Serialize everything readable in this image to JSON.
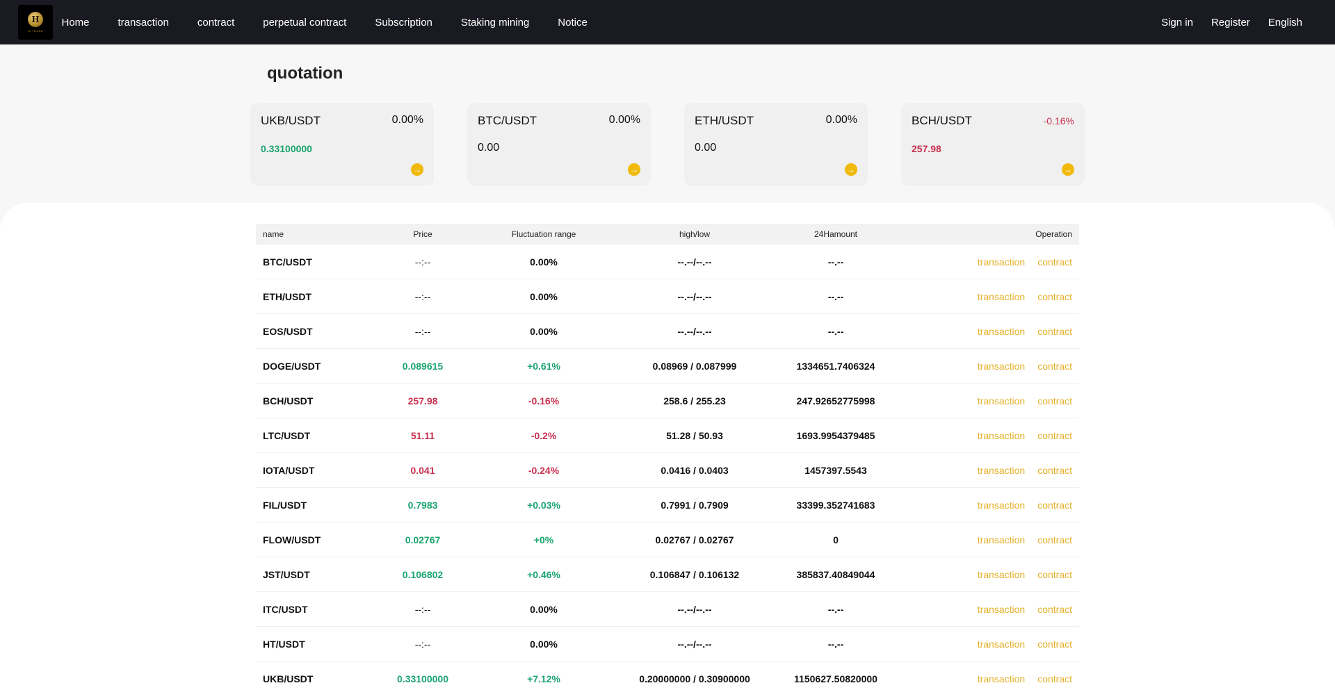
{
  "nav": {
    "logo_mark": "H",
    "logo_text": "HI TRADE",
    "links": [
      "Home",
      "transaction",
      "contract",
      "perpetual contract",
      "Subscription",
      "Staking mining",
      "Notice"
    ],
    "sign_in": "Sign in",
    "register": "Register",
    "language": "English"
  },
  "page_title": "quotation",
  "cards": [
    {
      "pair": "UKB/USDT",
      "change": "0.00%",
      "price": "0.33100000",
      "trend": "up"
    },
    {
      "pair": "BTC/USDT",
      "change": "0.00%",
      "price": "0.00",
      "trend": "flat"
    },
    {
      "pair": "ETH/USDT",
      "change": "0.00%",
      "price": "0.00",
      "trend": "flat"
    },
    {
      "pair": "BCH/USDT",
      "change": "-0.16%",
      "price": "257.98",
      "trend": "down"
    }
  ],
  "table": {
    "headers": {
      "name": "name",
      "price": "Price",
      "fluctuation": "Fluctuation range",
      "highlow": "high/low",
      "amount": "24Hamount",
      "operation": "Operation"
    },
    "op_transaction": "transaction",
    "op_contract": "contract",
    "rows": [
      {
        "name": "BTC/USDT",
        "price": "--:--",
        "change": "0.00%",
        "highlow": "--.--/--.--",
        "amount": "--.--",
        "trend": "flat"
      },
      {
        "name": "ETH/USDT",
        "price": "--:--",
        "change": "0.00%",
        "highlow": "--.--/--.--",
        "amount": "--.--",
        "trend": "flat"
      },
      {
        "name": "EOS/USDT",
        "price": "--:--",
        "change": "0.00%",
        "highlow": "--.--/--.--",
        "amount": "--.--",
        "trend": "flat"
      },
      {
        "name": "DOGE/USDT",
        "price": "0.089615",
        "change": "+0.61%",
        "highlow": "0.08969 / 0.087999",
        "amount": "1334651.7406324",
        "trend": "up"
      },
      {
        "name": "BCH/USDT",
        "price": "257.98",
        "change": "-0.16%",
        "highlow": "258.6 / 255.23",
        "amount": "247.92652775998",
        "trend": "down"
      },
      {
        "name": "LTC/USDT",
        "price": "51.11",
        "change": "-0.2%",
        "highlow": "51.28 / 50.93",
        "amount": "1693.9954379485",
        "trend": "down"
      },
      {
        "name": "IOTA/USDT",
        "price": "0.041",
        "change": "-0.24%",
        "highlow": "0.0416 / 0.0403",
        "amount": "1457397.5543",
        "trend": "down"
      },
      {
        "name": "FIL/USDT",
        "price": "0.7983",
        "change": "+0.03%",
        "highlow": "0.7991 / 0.7909",
        "amount": "33399.352741683",
        "trend": "up"
      },
      {
        "name": "FLOW/USDT",
        "price": "0.02767",
        "change": "+0%",
        "highlow": "0.02767 / 0.02767",
        "amount": "0",
        "trend": "up"
      },
      {
        "name": "JST/USDT",
        "price": "0.106802",
        "change": "+0.46%",
        "highlow": "0.106847 / 0.106132",
        "amount": "385837.40849044",
        "trend": "up"
      },
      {
        "name": "ITC/USDT",
        "price": "--:--",
        "change": "0.00%",
        "highlow": "--.--/--.--",
        "amount": "--.--",
        "trend": "flat"
      },
      {
        "name": "HT/USDT",
        "price": "--:--",
        "change": "0.00%",
        "highlow": "--.--/--.--",
        "amount": "--.--",
        "trend": "flat"
      },
      {
        "name": "UKB/USDT",
        "price": "0.33100000",
        "change": "+7.12%",
        "highlow": "0.20000000 / 0.30900000",
        "amount": "1150627.50820000",
        "trend": "up"
      }
    ]
  },
  "colors": {
    "up": "#1aa470",
    "down": "#c8304e",
    "accent": "#f0b90b",
    "link": "#e5b12a",
    "nav_bg": "#1a1b22"
  }
}
